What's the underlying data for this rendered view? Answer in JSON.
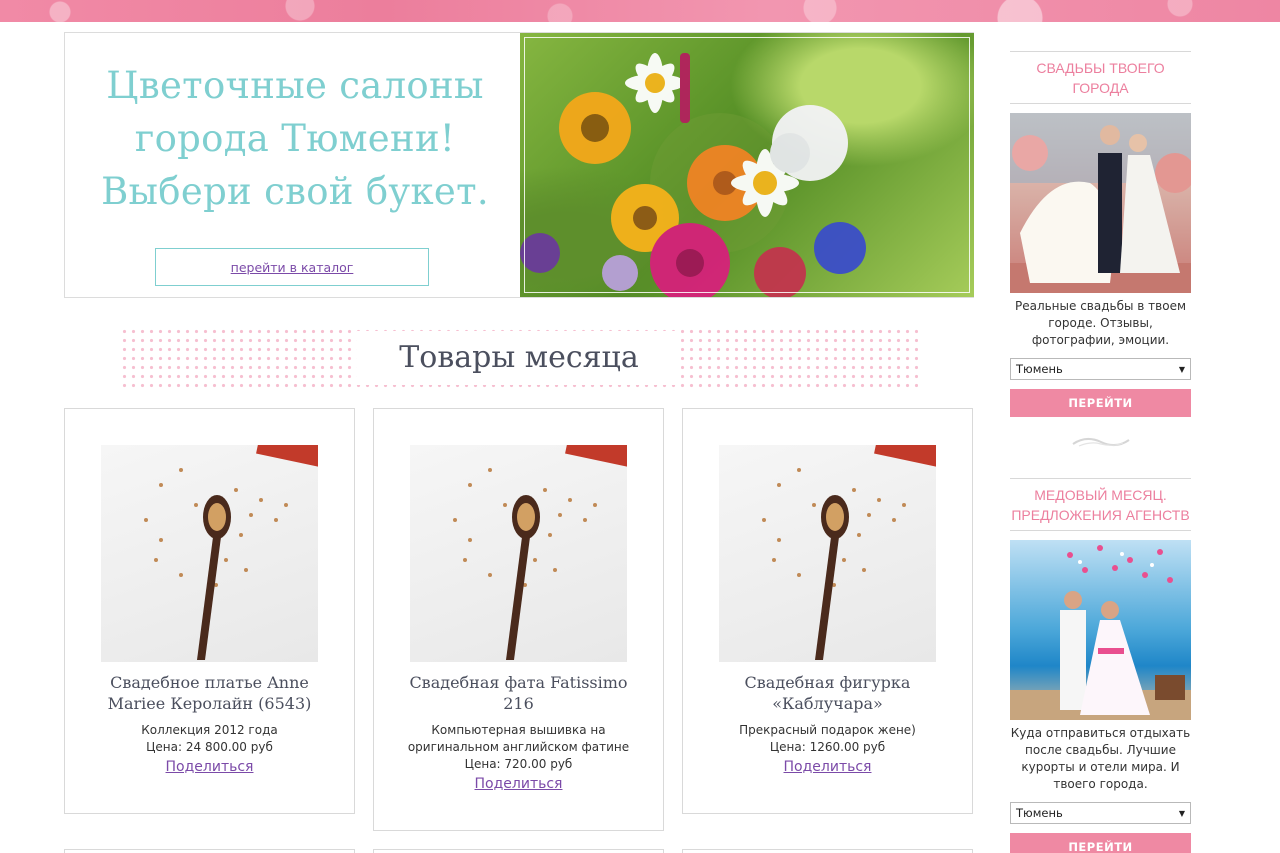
{
  "hero": {
    "title_lines": [
      "Цветочные салоны",
      "города Тюмени!",
      "Выбери свой букет."
    ],
    "catalog_link": "перейти в каталог"
  },
  "section": {
    "title": "Товары месяца"
  },
  "products": [
    {
      "name": "Свадебное платье Anne Mariee Керолайн (6543)",
      "description": "Коллекция 2012 года",
      "price": "Цена: 24 800.00 руб",
      "share": "Поделиться"
    },
    {
      "name": "Свадебная фата Fatissimo 216",
      "description": "Компьютерная вышивка на оригинальном английском фатине",
      "price": "Цена: 720.00 руб",
      "share": "Поделиться"
    },
    {
      "name": "Свадебная фигурка «Каблучара»",
      "description": "Прекрасный подарок жене)",
      "price": "Цена: 1260.00 руб",
      "share": "Поделиться"
    }
  ],
  "sidebar": {
    "widgets": [
      {
        "title": "СВАДЬБЫ ТВОЕГО ГОРОДА",
        "text": "Реальные свадьбы в твоем городе. Отзывы, фотографии, эмоции.",
        "select_value": "Тюмень",
        "button": "ПЕРЕЙТИ"
      },
      {
        "title": "МЕДОВЫЙ МЕСЯЦ. ПРЕДЛОЖЕНИЯ АГЕНСТВ",
        "text": "Куда отправиться отдыхать после свадьбы. Лучшие курорты и отели мира. И твоего города.",
        "select_value": "Тюмень",
        "button": "ПЕРЕЙТИ"
      }
    ]
  },
  "colors": {
    "accent_pink": "#ef89a3",
    "title_teal": "#7fcfd0",
    "link_purple": "#7b4aa8"
  }
}
